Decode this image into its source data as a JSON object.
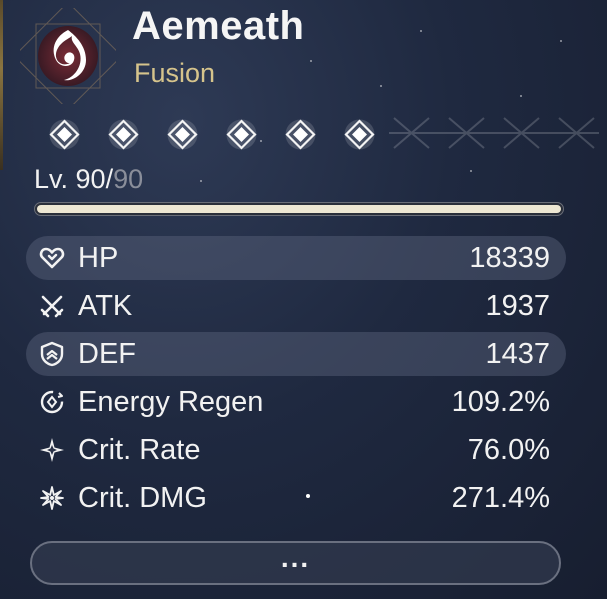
{
  "character": {
    "name": "Aemeath",
    "element": "Fusion",
    "element_icon": "fusion-flame-icon"
  },
  "sequence": {
    "nodes": [
      {
        "icon": "diamond-icon",
        "active": true
      },
      {
        "icon": "diamond-icon",
        "active": true
      },
      {
        "icon": "diamond-icon",
        "active": true
      },
      {
        "icon": "diamond-icon",
        "active": true
      },
      {
        "icon": "diamond-icon",
        "active": true
      },
      {
        "icon": "diamond-icon",
        "active": true
      }
    ]
  },
  "level": {
    "prefix": "Lv. ",
    "current": "90",
    "separator": "/",
    "max": "90",
    "progress": 1.0
  },
  "stats": [
    {
      "label": "HP",
      "value": "18339",
      "icon": "heart-icon"
    },
    {
      "label": "ATK",
      "value": "1937",
      "icon": "crossed-swords-icon"
    },
    {
      "label": "DEF",
      "value": "1437",
      "icon": "shield-icon"
    },
    {
      "label": "Energy Regen",
      "value": "109.2%",
      "icon": "energy-regen-icon"
    },
    {
      "label": "Crit. Rate",
      "value": "76.0%",
      "icon": "crit-rate-icon"
    },
    {
      "label": "Crit. DMG",
      "value": "271.4%",
      "icon": "crit-dmg-icon"
    }
  ],
  "more_button": {
    "label": "..."
  },
  "colors": {
    "element": "#d6c48c",
    "level_fill": "#ede7d3",
    "level_max": "#8a8e9a"
  }
}
